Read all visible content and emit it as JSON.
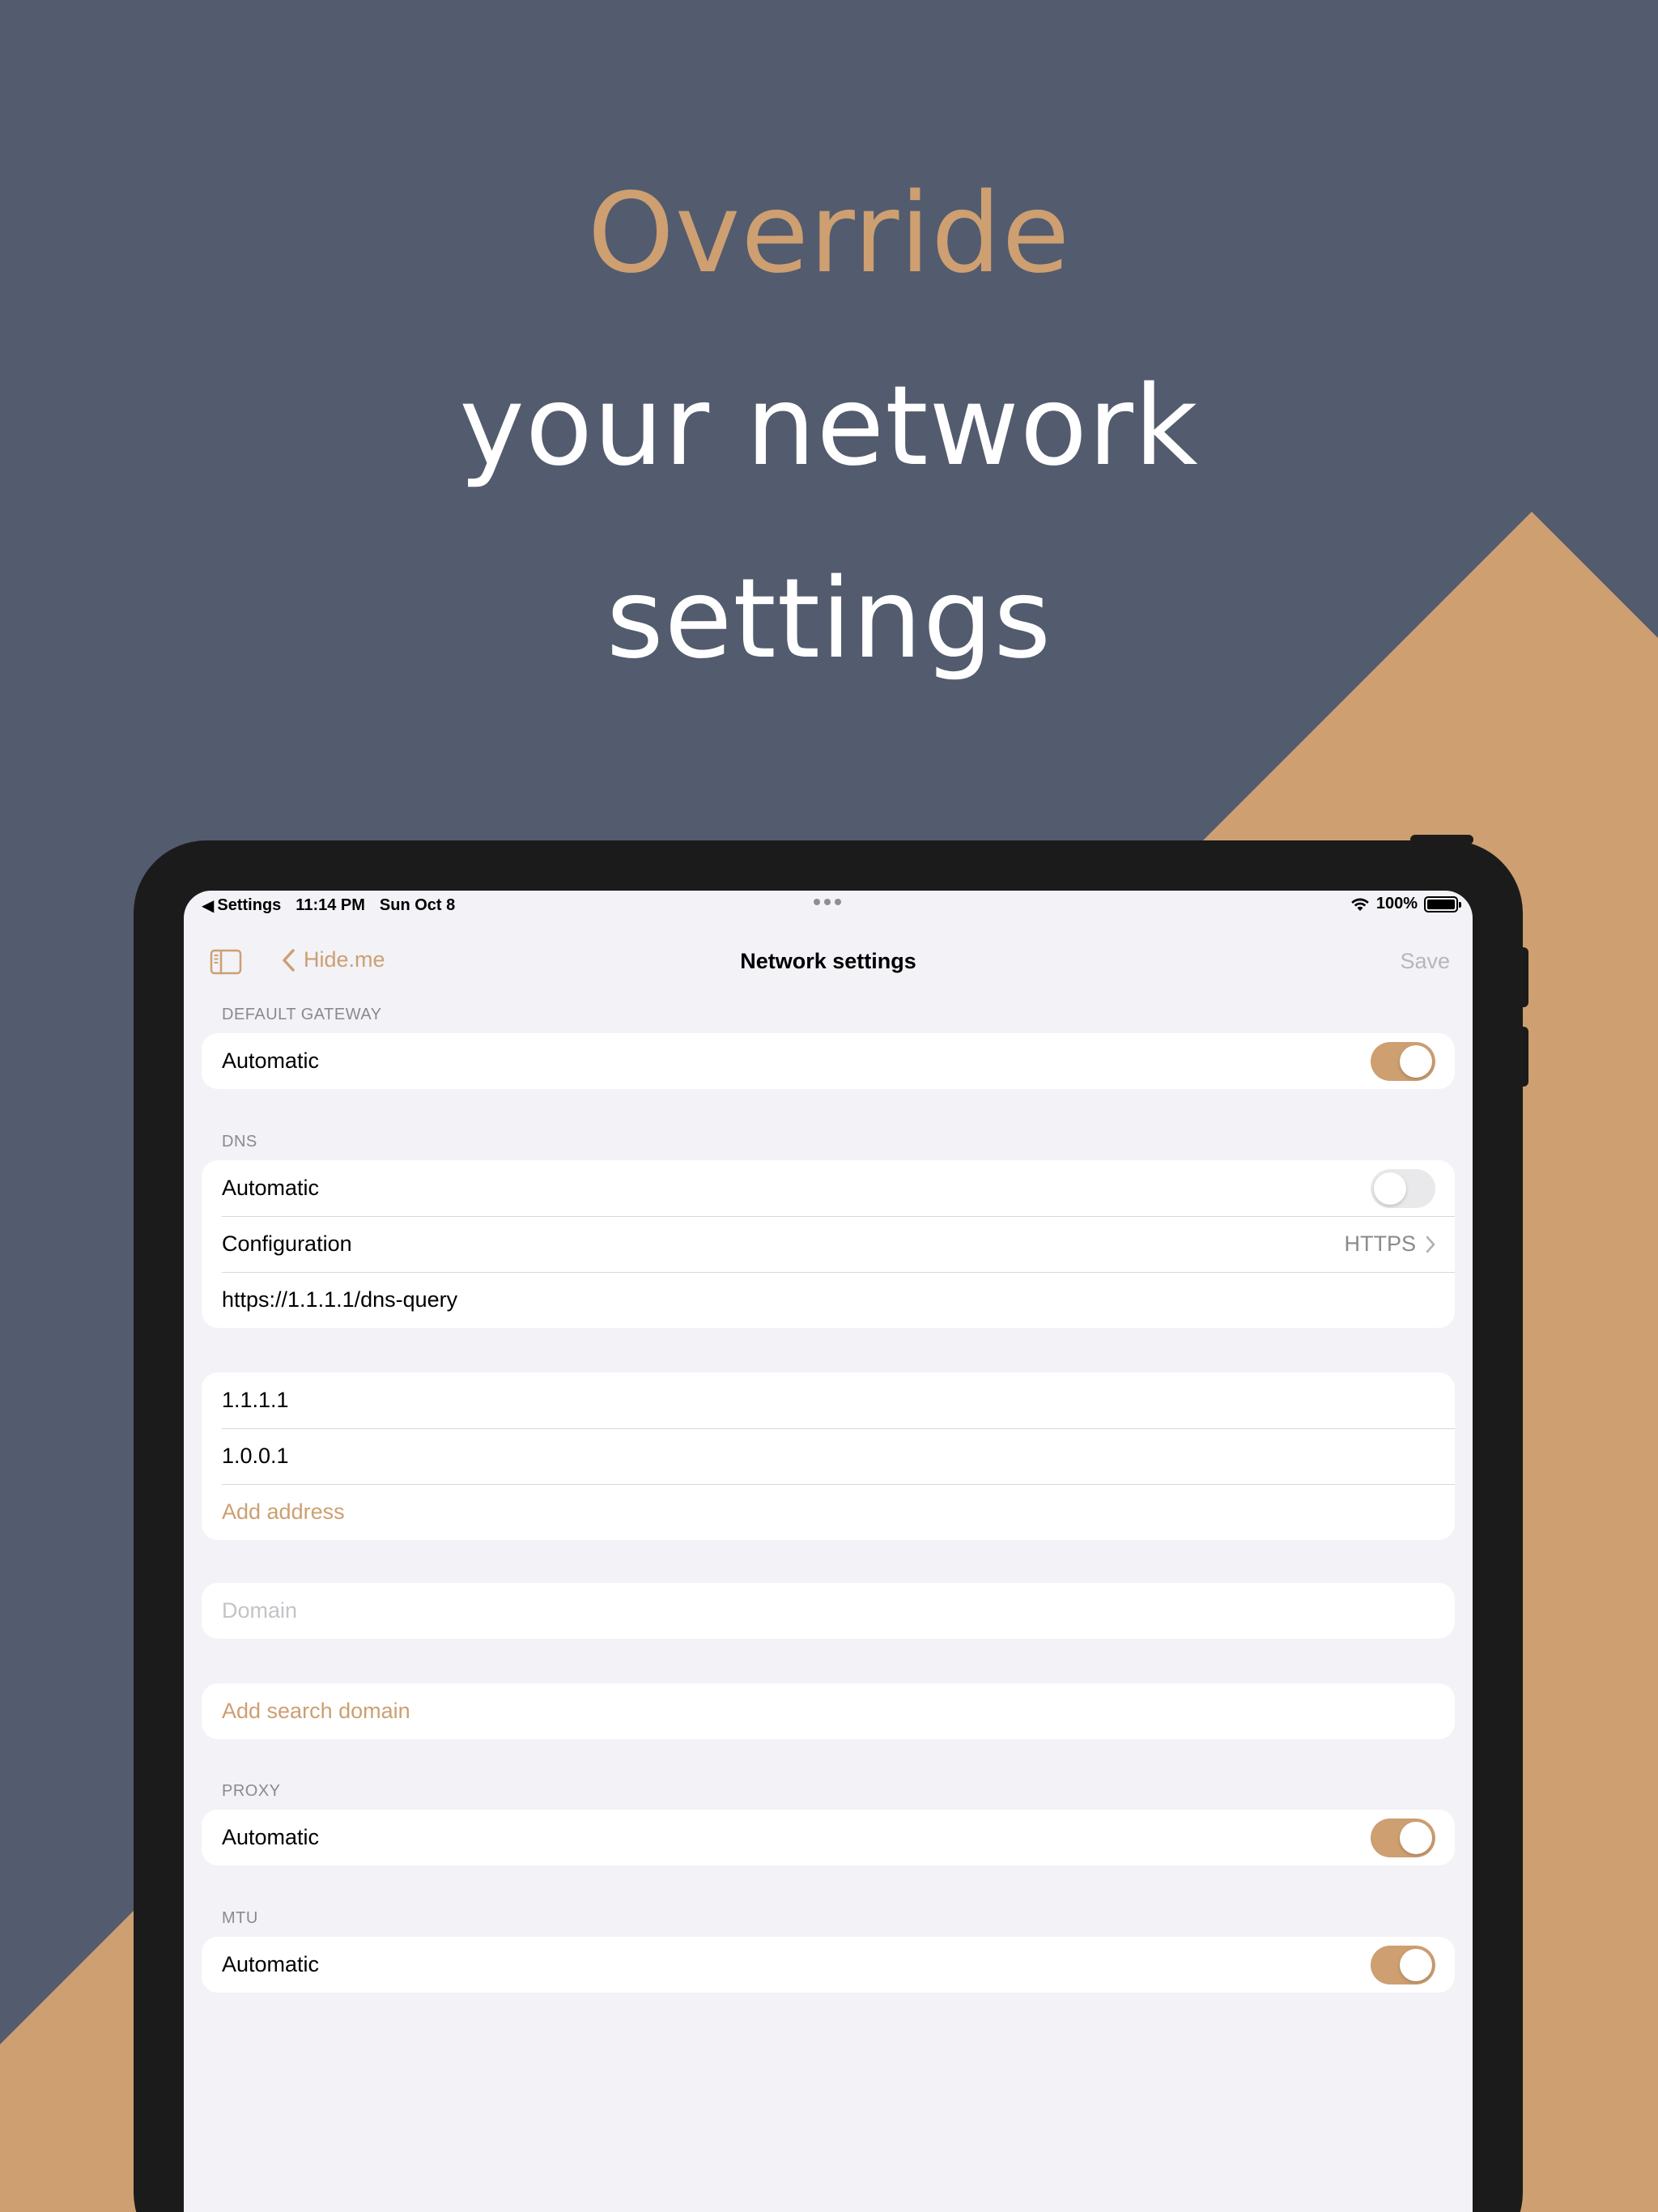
{
  "headline": {
    "line1": "Override",
    "line2": "your network",
    "line3": "settings"
  },
  "colors": {
    "background": "#535b6e",
    "accent": "#cd9f71",
    "device": "#1b1b1b",
    "screen_bg": "#f2f2f7"
  },
  "status_bar": {
    "back_app": "Settings",
    "time": "11:14 PM",
    "date": "Sun Oct 8",
    "battery": "100%",
    "icons": [
      "back-arrow-icon",
      "multitask-dots-icon",
      "wifi-icon",
      "battery-icon"
    ]
  },
  "nav": {
    "sidebar_icon": "sidebar-icon",
    "back_label": "Hide.me",
    "title": "Network settings",
    "save_label": "Save"
  },
  "sections": {
    "default_gateway": {
      "header": "DEFAULT GATEWAY",
      "automatic_label": "Automatic",
      "automatic_on": true
    },
    "dns": {
      "header": "DNS",
      "automatic_label": "Automatic",
      "automatic_on": false,
      "configuration_label": "Configuration",
      "configuration_value": "HTTPS",
      "url_value": "https://1.1.1.1/dns-query"
    },
    "addresses": {
      "items": [
        "1.1.1.1",
        "1.0.0.1"
      ],
      "add_label": "Add address"
    },
    "domain": {
      "placeholder": "Domain"
    },
    "search_domain": {
      "add_label": "Add search domain"
    },
    "proxy": {
      "header": "PROXY",
      "automatic_label": "Automatic",
      "automatic_on": true
    },
    "mtu": {
      "header": "MTU",
      "automatic_label": "Automatic",
      "automatic_on": true
    }
  }
}
